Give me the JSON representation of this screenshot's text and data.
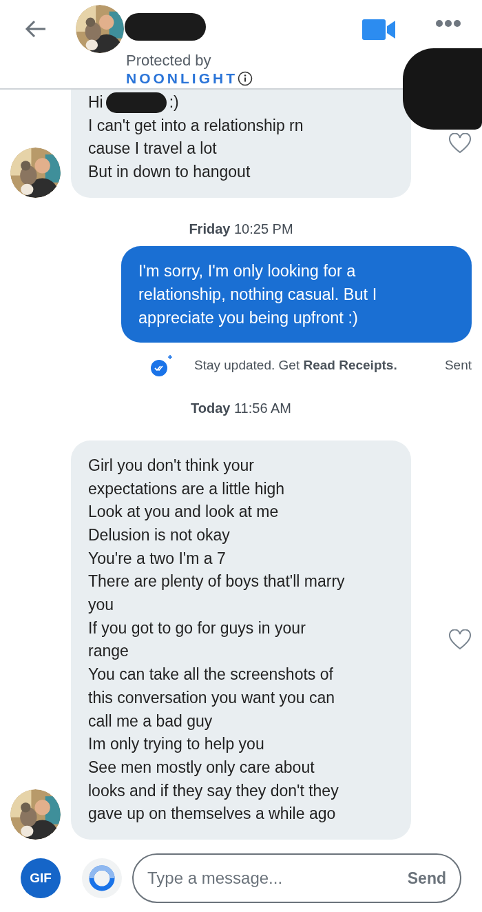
{
  "header": {
    "name_redacted": true,
    "protected_label": "Protected by",
    "brand": "NOONLIGHT"
  },
  "messages": [
    {
      "kind": "received",
      "liked": false,
      "avatar": true,
      "first_line": {
        "before": "Hi",
        "after": ":)",
        "redacted": true
      },
      "lines": [
        "I can't get into a relationship rn",
        "cause I travel a lot",
        "But in down to hangout"
      ]
    },
    {
      "kind": "timestamp",
      "text": "**Friday** 10:25 PM"
    },
    {
      "kind": "sent",
      "lines": [
        "I'm sorry, I'm only looking for a",
        "relationship, nothing casual. But I",
        "appreciate you being upfront :)"
      ]
    },
    {
      "kind": "receipt",
      "text": "Stay updated. Get **Read Receipts.**",
      "status": "Sent"
    },
    {
      "kind": "timestamp",
      "text": "**Today** 11:56 AM"
    },
    {
      "kind": "received",
      "liked": false,
      "avatar": true,
      "lines": [
        "Girl you don't think your",
        "expectations are a little high",
        "Look at you and look at me",
        "Delusion is not okay",
        "You're a two I'm a 7",
        "There are plenty of boys that'll marry",
        "you",
        "If you got to go for guys in your",
        "range",
        "You can take all the screenshots of",
        "this conversation you want you can",
        "call me a bad guy",
        "Im only trying to help you",
        "See men mostly only care about",
        "looks and if they say they don't they",
        "gave up on themselves a while ago"
      ]
    }
  ],
  "composer": {
    "gif": "GIF",
    "placeholder": "Type a message...",
    "send": "Send"
  }
}
